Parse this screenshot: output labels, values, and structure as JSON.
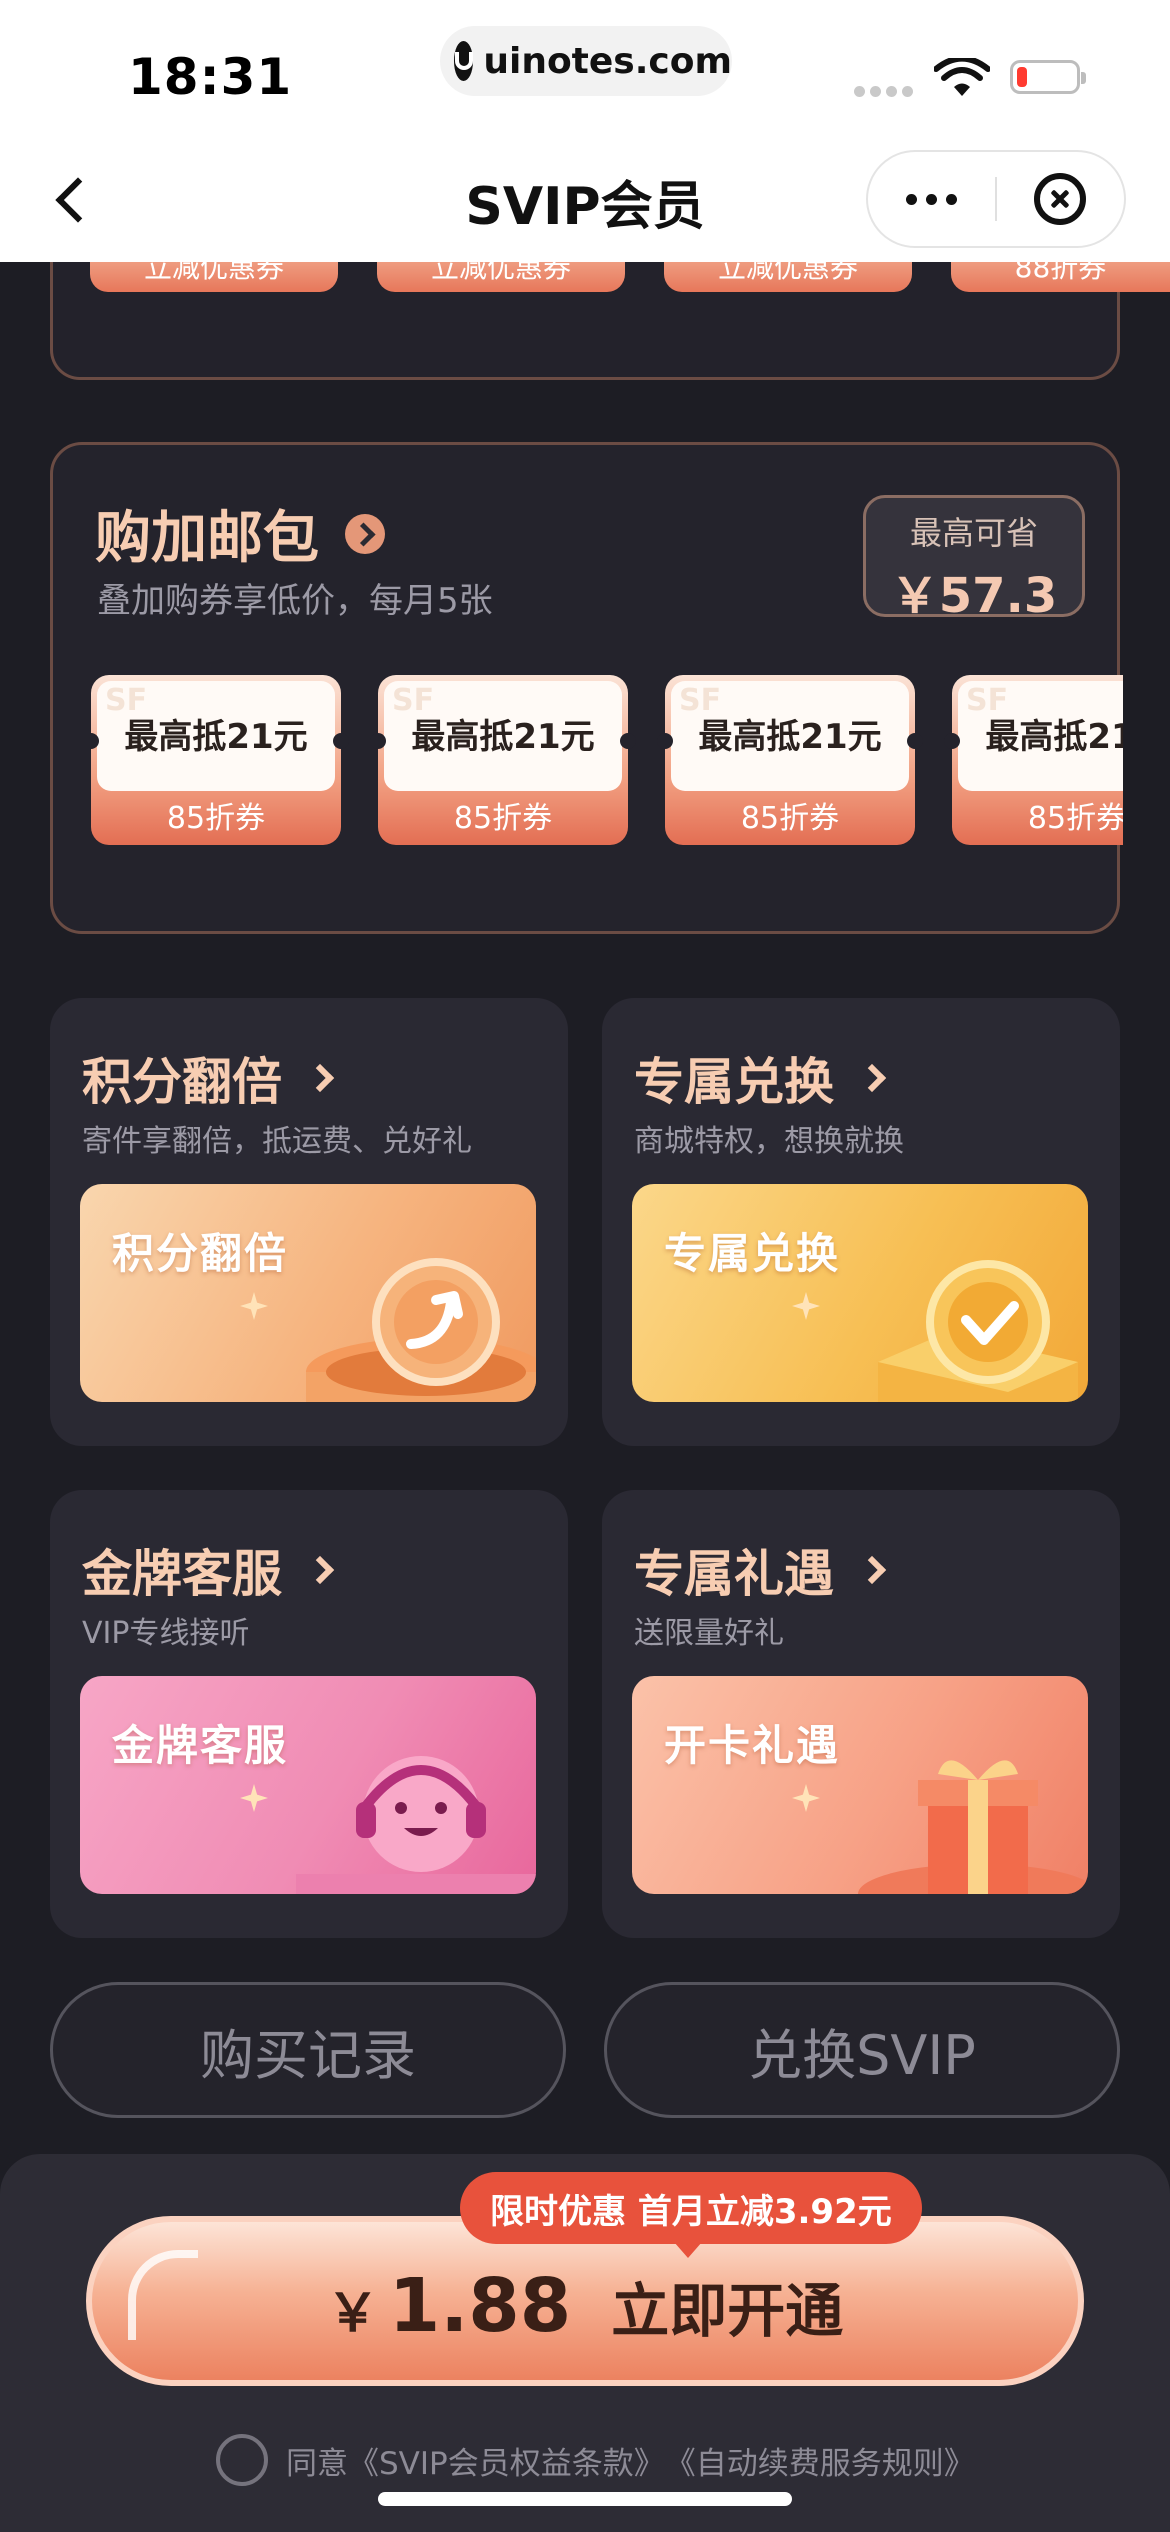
{
  "status_bar": {
    "time": "18:31",
    "url": "uinotes.com"
  },
  "nav": {
    "title": "SVIP会员"
  },
  "prev_card": {
    "chips": [
      "立减优惠券",
      "立减优惠券",
      "立减优惠券",
      "88折券"
    ]
  },
  "bundle": {
    "title": "购加邮包",
    "subtitle": "叠加购券享低价，每月5张",
    "save_label": "最高可省",
    "save_value": "￥57.3",
    "watermark": "SF",
    "coupons": [
      {
        "amount": "最高抵21元",
        "type": "85折券"
      },
      {
        "amount": "最高抵21元",
        "type": "85折券"
      },
      {
        "amount": "最高抵21元",
        "type": "85折券"
      },
      {
        "amount": "最高抵21元",
        "type": "85折券"
      }
    ]
  },
  "benefits": [
    {
      "title": "积分翻倍",
      "desc": "寄件享翻倍，抵运费、兑好礼",
      "banner": "积分翻倍"
    },
    {
      "title": "专属兑换",
      "desc": "商城特权，想换就换",
      "banner": "专属兑换"
    },
    {
      "title": "金牌客服",
      "desc": "VIP专线接听",
      "banner": "金牌客服"
    },
    {
      "title": "专属礼遇",
      "desc": "送限量好礼",
      "banner": "开卡礼遇"
    }
  ],
  "actions": {
    "purchase_record": "购买记录",
    "redeem_svip": "兑换SVIP"
  },
  "pay": {
    "promo": "限时优惠  首月立减3.92元",
    "currency": "￥",
    "price": "1.88",
    "action": "立即开通"
  },
  "agreement": {
    "prefix": "同意",
    "terms1": "《SVIP会员权益条款》",
    "terms2": "《自动续费服务规则》"
  }
}
